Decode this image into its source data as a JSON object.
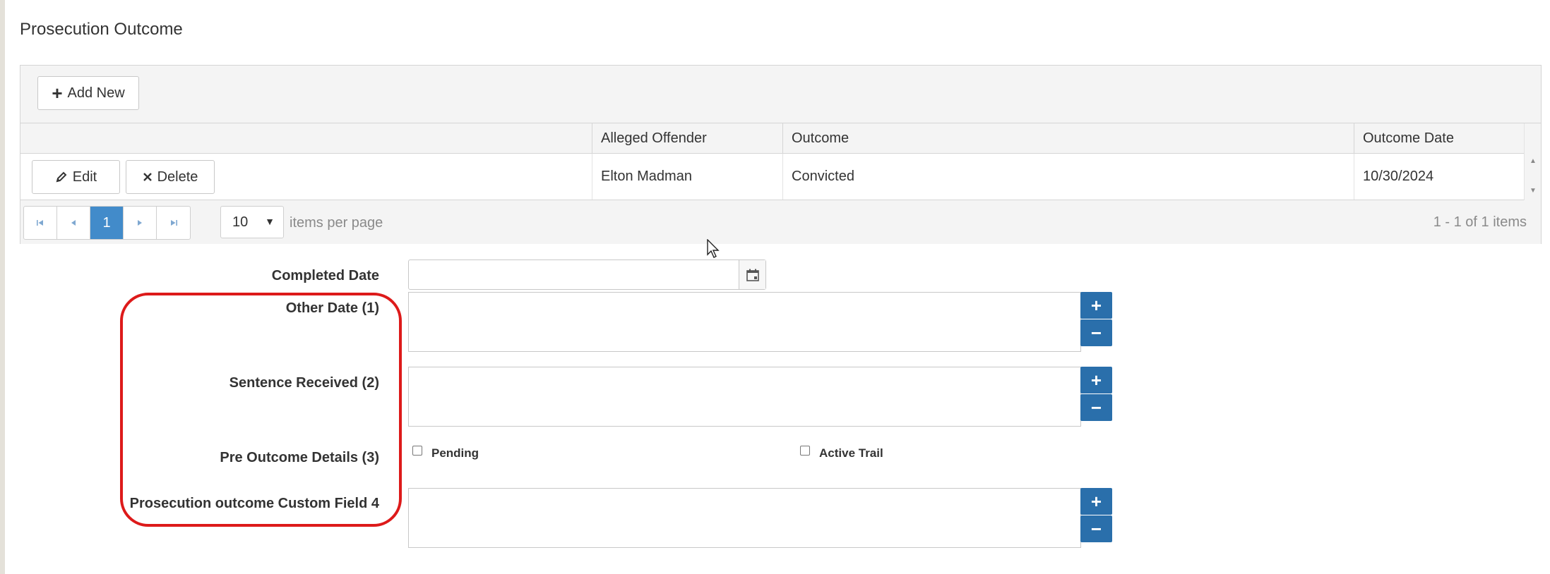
{
  "page": {
    "title": "Prosecution Outcome"
  },
  "grid": {
    "add_button_label": "Add New",
    "columns": [
      "Alleged Offender",
      "Outcome",
      "Outcome Date"
    ],
    "rows": [
      {
        "alleged_offender": "Elton Madman",
        "outcome": "Convicted",
        "outcome_date": "10/30/2024"
      }
    ],
    "row_actions": {
      "edit_label": "Edit",
      "delete_label": "Delete"
    },
    "pager": {
      "current_page": "1",
      "page_size": "10",
      "per_page_label": "items per page",
      "info": "1 - 1 of 1 items"
    }
  },
  "form": {
    "completed_date_label": "Completed Date",
    "completed_date_value": "",
    "other_date_label": "Other Date (1)",
    "sentence_received_label": "Sentence Received (2)",
    "pre_outcome_details_label": "Pre Outcome Details (3)",
    "pre_outcome_options": [
      {
        "label": "Pending",
        "checked": false
      },
      {
        "label": "Active Trail",
        "checked": false
      }
    ],
    "custom_field_4_label": "Prosecution outcome Custom Field 4"
  },
  "colors": {
    "primary_button": "#2a6fab",
    "active_page": "#428bca",
    "highlight_border": "#dd1a1a"
  },
  "icons": [
    "plus-icon",
    "pencil-icon",
    "times-icon",
    "calendar-icon",
    "first-page-icon",
    "prev-page-icon",
    "next-page-icon",
    "last-page-icon",
    "mouse-cursor-icon"
  ]
}
